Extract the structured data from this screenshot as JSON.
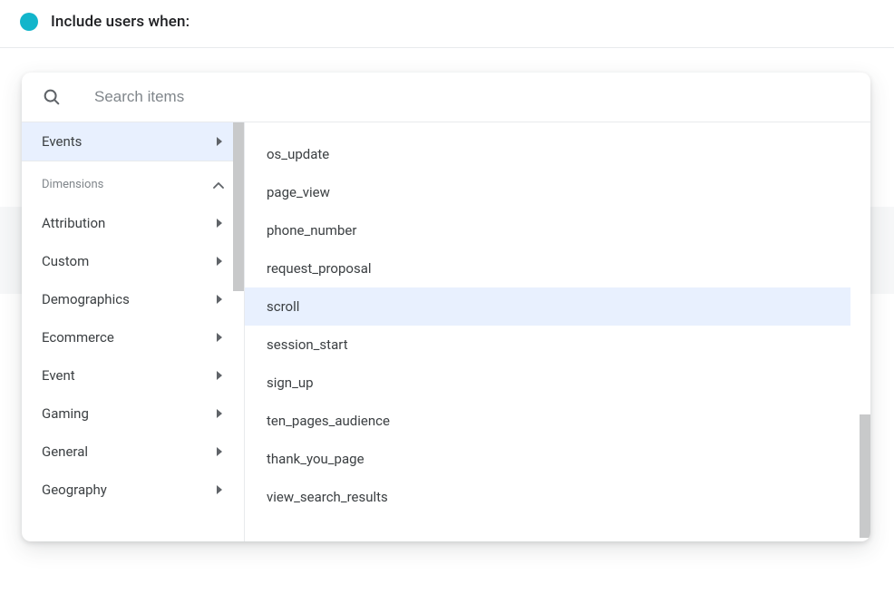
{
  "header": {
    "title": "Include users when:"
  },
  "search": {
    "placeholder": "Search items"
  },
  "sidebar": {
    "events_label": "Events",
    "dimensions_label": "Dimensions",
    "categories": [
      {
        "label": "Attribution"
      },
      {
        "label": "Custom"
      },
      {
        "label": "Demographics"
      },
      {
        "label": "Ecommerce"
      },
      {
        "label": "Event"
      },
      {
        "label": "Gaming"
      },
      {
        "label": "General"
      },
      {
        "label": "Geography"
      }
    ]
  },
  "events": [
    {
      "label": "os_update",
      "highlighted": false
    },
    {
      "label": "page_view",
      "highlighted": false
    },
    {
      "label": "phone_number",
      "highlighted": false
    },
    {
      "label": "request_proposal",
      "highlighted": false
    },
    {
      "label": "scroll",
      "highlighted": true
    },
    {
      "label": "session_start",
      "highlighted": false
    },
    {
      "label": "sign_up",
      "highlighted": false
    },
    {
      "label": "ten_pages_audience",
      "highlighted": false
    },
    {
      "label": "thank_you_page",
      "highlighted": false
    },
    {
      "label": "view_search_results",
      "highlighted": false
    }
  ]
}
